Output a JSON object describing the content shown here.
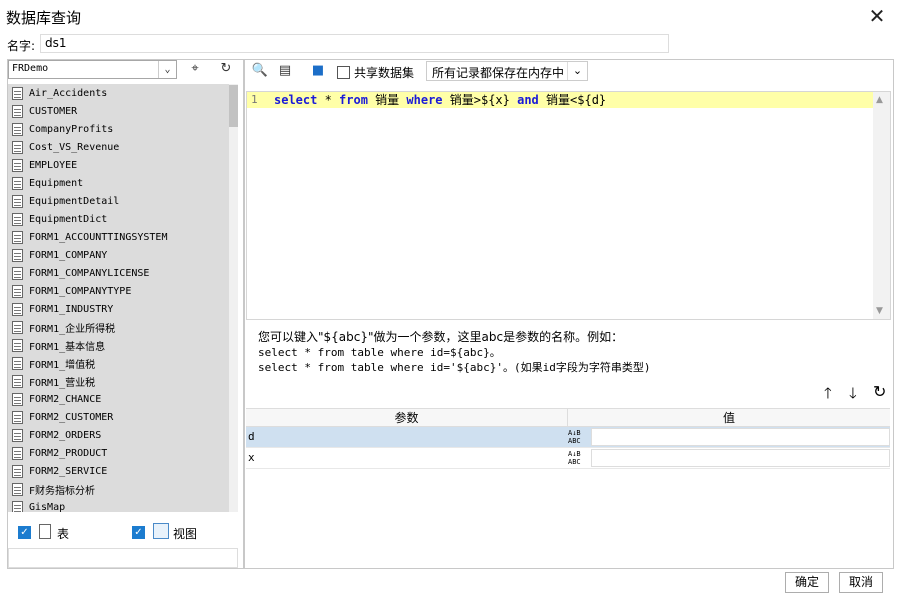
{
  "window": {
    "title": "数据库查询",
    "close_icon": "close-icon"
  },
  "name_field": {
    "label": "名字:",
    "value": "ds1"
  },
  "left": {
    "datasource": "FRDemo",
    "tables": [
      "Air_Accidents",
      "CUSTOMER",
      "CompanyProfits",
      "Cost_VS_Revenue",
      "EMPLOYEE",
      "Equipment",
      "EquipmentDetail",
      "EquipmentDict",
      "FORM1_ACCOUNTTINGSYSTEM",
      "FORM1_COMPANY",
      "FORM1_COMPANYLICENSE",
      "FORM1_COMPANYTYPE",
      "FORM1_INDUSTRY",
      "FORM1_企业所得税",
      "FORM1_基本信息",
      "FORM1_增值税",
      "FORM1_营业税",
      "FORM2_CHANCE",
      "FORM2_CUSTOMER",
      "FORM2_ORDERS",
      "FORM2_PRODUCT",
      "FORM2_SERVICE",
      "F财务指标分析",
      "GisMap"
    ],
    "show_tables_label": "表",
    "show_views_label": "视图"
  },
  "toolbar": {
    "share_dataset_label": "共享数据集",
    "storage_mode": "所有记录都保存在内存中"
  },
  "editor": {
    "line_number": "1",
    "sql": {
      "t1": "select",
      "t2": " * ",
      "t3": "from",
      "t4": " 销量 ",
      "t5": "where",
      "t6": " 销量>${x} ",
      "t7": "and",
      "t8": " 销量<${d}"
    }
  },
  "help": {
    "line1": "您可以键入\"${abc}\"做为一个参数，这里abc是参数的名称。例如：",
    "line2": "select * from table where id=${abc}。",
    "line3": "select * from table where id='${abc}'。(如果id字段为字符串类型)"
  },
  "params": {
    "col_name": "参数",
    "col_value": "值",
    "type_label_top": "A↓B",
    "type_label_bottom": "ABC",
    "rows": [
      {
        "name": "d",
        "value": ""
      },
      {
        "name": "x",
        "value": ""
      }
    ]
  },
  "buttons": {
    "ok": "确定",
    "cancel": "取消"
  },
  "colors": {
    "selected_row": "#cfe0f0",
    "sql_line_highlight": "#ffffa8",
    "keyword": "#1a1ad8",
    "checkbox": "#1c7ccf"
  }
}
